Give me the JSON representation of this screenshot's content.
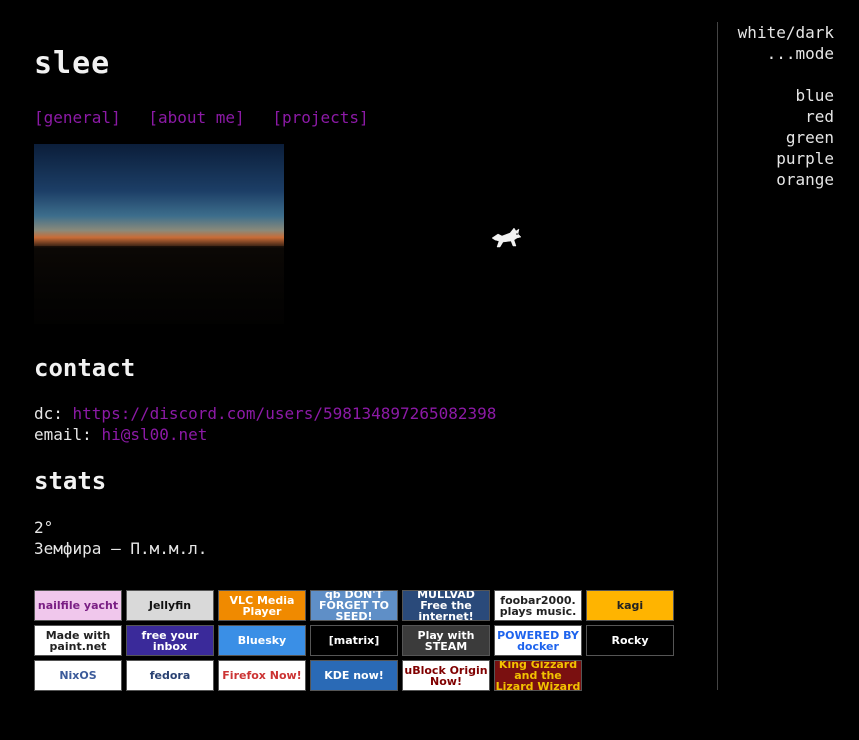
{
  "site_title": "slee",
  "nav": [
    "[general]",
    "[about me]",
    "[projects]"
  ],
  "photo_alt": "sunset photo",
  "contact": {
    "heading": "contact",
    "dc_label": "dc: ",
    "dc_value": "https://discord.com/users/598134897265082398",
    "email_label": "email: ",
    "email_value": "hi@sl00.net"
  },
  "stats": {
    "heading": "stats",
    "temperature": "2°",
    "now_playing": "Земфира – П.м.м.л."
  },
  "badges": [
    {
      "label": "nailfile yacht",
      "bg": "#f0c7ec",
      "fg": "#7a1f84"
    },
    {
      "label": "Jellyfin",
      "bg": "#d9d9d9",
      "fg": "#111"
    },
    {
      "label": "VLC Media Player",
      "bg": "#f08a00",
      "fg": "#fff"
    },
    {
      "label": "qb DON'T FORGET TO SEED!",
      "bg": "#5f8fc7",
      "fg": "#fff"
    },
    {
      "label": "MULLVAD Free the internet!",
      "bg": "#2a4a7a",
      "fg": "#fff"
    },
    {
      "label": "foobar2000. plays music.",
      "bg": "#ffffff",
      "fg": "#222"
    },
    {
      "label": "kagi",
      "bg": "#ffb400",
      "fg": "#222"
    },
    {
      "label": "Made with paint.net",
      "bg": "#ffffff",
      "fg": "#222"
    },
    {
      "label": "free your inbox",
      "bg": "#3a2a9a",
      "fg": "#fff"
    },
    {
      "label": "Bluesky",
      "bg": "#3a8fe6",
      "fg": "#fff"
    },
    {
      "label": "[matrix]",
      "bg": "#000000",
      "fg": "#fff"
    },
    {
      "label": "Play with STEAM",
      "bg": "#3b3b3b",
      "fg": "#fff"
    },
    {
      "label": "POWERED BY docker",
      "bg": "#ffffff",
      "fg": "#1d63ed"
    },
    {
      "label": "Rocky",
      "bg": "#000000",
      "fg": "#fff"
    },
    {
      "label": "NixOS",
      "bg": "#ffffff",
      "fg": "#3b5a9a"
    },
    {
      "label": "fedora",
      "bg": "#ffffff",
      "fg": "#294172"
    },
    {
      "label": "Firefox Now!",
      "bg": "#ffffff",
      "fg": "#c33"
    },
    {
      "label": "KDE now!",
      "bg": "#2a6ab6",
      "fg": "#fff"
    },
    {
      "label": "uBlock Origin Now!",
      "bg": "#ffffff",
      "fg": "#800000"
    },
    {
      "label": "King Gizzard and the Lizard Wizard",
      "bg": "#7a1010",
      "fg": "#f2c200"
    }
  ],
  "sidebar": {
    "mode_line1": "white/dark",
    "mode_line2": "...mode",
    "colors": [
      "blue",
      "red",
      "green",
      "purple",
      "orange"
    ]
  }
}
